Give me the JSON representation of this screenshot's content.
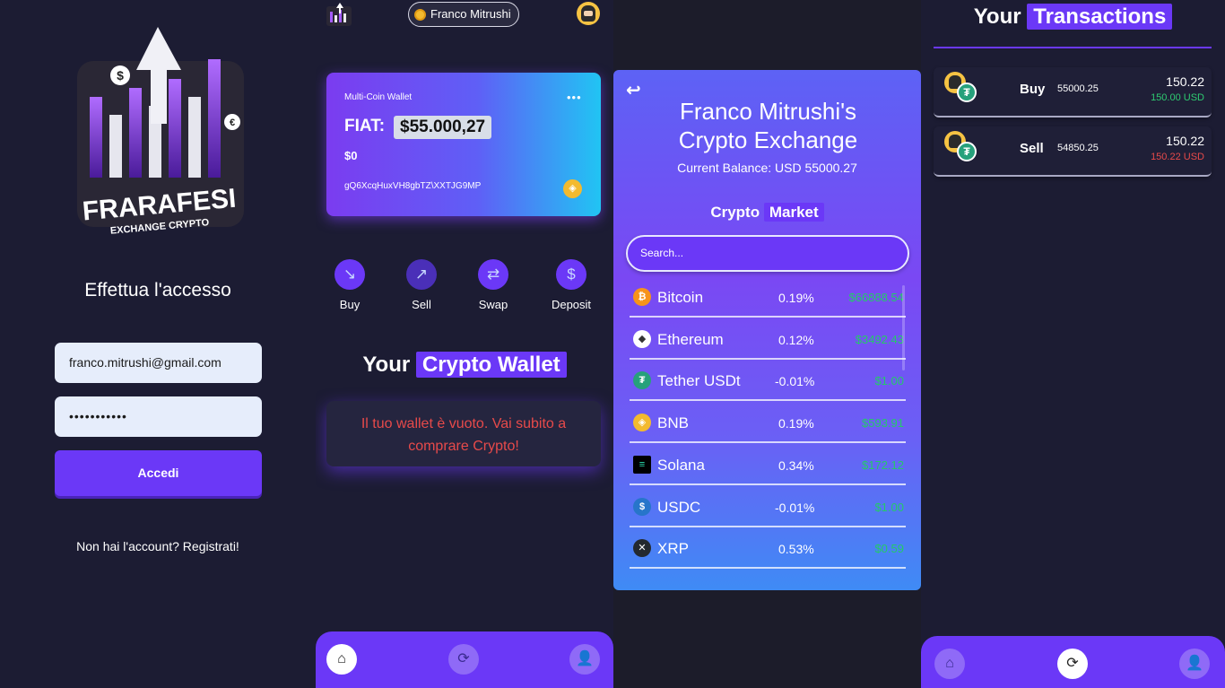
{
  "login": {
    "logo_text": "FRARAFESI",
    "logo_subtext": "EXCHANGE CRYPTO",
    "title": "Effettua l'accesso",
    "email": "franco.mitrushi@gmail.com",
    "password": "•••••••••••",
    "submit_label": "Accedi",
    "register_text": "Non hai l'account? Registrati!"
  },
  "wallet": {
    "user_name": "Franco Mitrushi",
    "card": {
      "label": "Multi-Coin Wallet",
      "menu": "•••",
      "fiat_label": "FIAT:",
      "fiat_value": "$55.000,27",
      "crypto_value": "$0",
      "address": "gQ6XcqHuxVH8gbTZ\\XXTJG9MP"
    },
    "actions": [
      {
        "label": "Buy",
        "icon": "↘"
      },
      {
        "label": "Sell",
        "icon": "↗"
      },
      {
        "label": "Swap",
        "icon": "⇄"
      },
      {
        "label": "Deposit",
        "icon": "$"
      }
    ],
    "section_title_a": "Your",
    "section_title_b": "Crypto Wallet",
    "empty_message": "Il tuo wallet è vuoto. Vai subito a comprare Crypto!"
  },
  "exchange": {
    "back_icon": "↩",
    "title": "Franco Mitrushi's Crypto Exchange",
    "balance": "Current Balance: USD 55000.27",
    "market_a": "Crypto",
    "market_b": "Market",
    "search_placeholder": "Search...",
    "coins": [
      {
        "name": "Bitcoin",
        "pct": "0.19%",
        "price": "$66888.54",
        "icon": "₿",
        "color": "#f7931a"
      },
      {
        "name": "Ethereum",
        "pct": "0.12%",
        "price": "$3492.43",
        "icon": "◆",
        "color": "#ffffff"
      },
      {
        "name": "Tether USDt",
        "pct": "-0.01%",
        "price": "$1.00",
        "icon": "₮",
        "color": "#26a17b"
      },
      {
        "name": "BNB",
        "pct": "0.19%",
        "price": "$593.91",
        "icon": "◈",
        "color": "#f3ba2f"
      },
      {
        "name": "Solana",
        "pct": "0.34%",
        "price": "$172.12",
        "icon": "≡",
        "color": "#000000"
      },
      {
        "name": "USDC",
        "pct": "-0.01%",
        "price": "$1.00",
        "icon": "$",
        "color": "#2775ca"
      },
      {
        "name": "XRP",
        "pct": "0.53%",
        "price": "$0.59",
        "icon": "✕",
        "color": "#23292f"
      }
    ]
  },
  "transactions": {
    "title_a": "Your",
    "title_b": "Transactions",
    "items": [
      {
        "type": "Buy",
        "amount": "55000.25",
        "value": "150.22",
        "usd": "150.00 USD",
        "usd_color": "#2ecc71"
      },
      {
        "type": "Sell",
        "amount": "54850.25",
        "value": "150.22",
        "usd": "150.22 USD",
        "usd_color": "#e74a4a"
      }
    ]
  },
  "nav": {
    "home_icon": "⌂",
    "swap_icon": "⟳",
    "profile_icon": "👤"
  }
}
